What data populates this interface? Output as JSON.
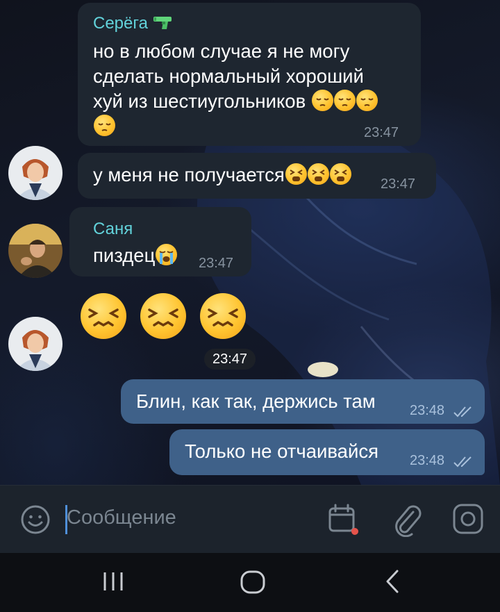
{
  "messages": [
    {
      "sender": "Серёга",
      "sender_icon": "pistol-icon",
      "lines": [
        "но в любом случае я не могу",
        "сделать нормальный хороший",
        "хуй из шестиугольников"
      ],
      "trailing_emoji": "pensive-face",
      "time": "23:47"
    },
    {
      "text": "у меня не получается",
      "trailing_emoji": "tired-face",
      "time": "23:47"
    },
    {
      "sender": "Саня",
      "text": "пиздец",
      "trailing_emoji": "loudly-crying-face",
      "time": "23:47"
    },
    {
      "big_emoji": "confounded-face",
      "time": "23:47"
    },
    {
      "text": "Блин, как так, держись там",
      "time": "23:48",
      "status": "read"
    },
    {
      "text": "Только не отчаивайся",
      "time": "23:48",
      "status": "read"
    }
  ],
  "input": {
    "placeholder": "Сообщение"
  },
  "colors": {
    "incoming_bubble": "#1e2630",
    "outgoing_bubble": "#3f6189",
    "sender_name": "#62d2da",
    "input_bar": "#1c232c"
  },
  "icons": [
    "emoji-icon",
    "schedule-calendar-icon",
    "attach-paperclip-icon",
    "camera-icon",
    "recent-apps-icon",
    "home-icon",
    "back-icon"
  ]
}
